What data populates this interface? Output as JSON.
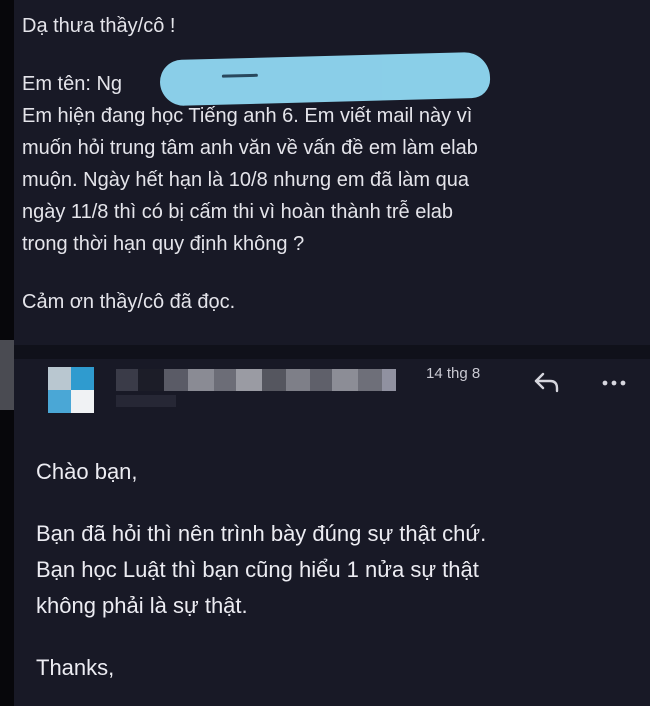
{
  "upper_message": {
    "greeting": "Dạ thưa thầy/cô !",
    "name_line": "Em tên: Ng",
    "body_lines": [
      "Em hiện đang học Tiếng anh 6. Em viết mail này vì",
      "muốn hỏi trung tâm anh văn về vấn đề em làm elab",
      "muộn. Ngày hết hạn là 10/8 nhưng em đã làm qua",
      "ngày 11/8 thì có bị cấm thi vì hoàn thành trễ elab",
      "trong thời hạn quy định không ?"
    ],
    "closing": "Cảm ơn thầy/cô đã đọc."
  },
  "reply_header": {
    "date": "14 thg 8",
    "reply_icon": "reply-arrow-icon",
    "more_icon": "more-horizontal-icon"
  },
  "reply_message": {
    "greeting": "Chào bạn,",
    "body_lines": [
      "Bạn đã hỏi thì nên trình bày đúng sự thật chứ.",
      "Bạn học Luật thì bạn cũng hiểu 1 nửa sự thật",
      "không phải là sự thật."
    ],
    "signoff": "Thanks,"
  },
  "colors": {
    "background": "#181926",
    "text": "#e4e4ea",
    "redaction": "#8fd6f0"
  }
}
